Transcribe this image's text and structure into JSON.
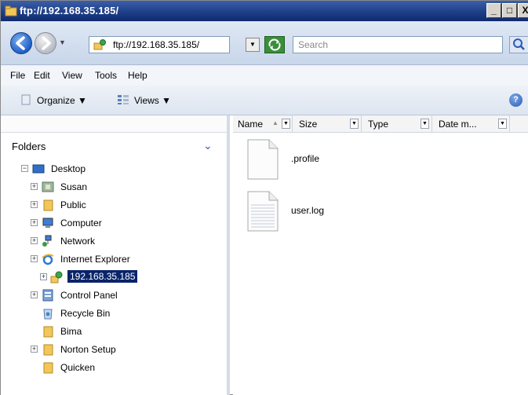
{
  "window": {
    "title": "ftp://192.168.35.185/",
    "controls": {
      "minimize": "_",
      "maximize": "□",
      "close": "X"
    }
  },
  "navbar": {
    "address": "ftp://192.168.35.185/",
    "search_placeholder": "Search"
  },
  "menu": {
    "items": [
      "File",
      "Edit",
      "View",
      "Tools",
      "Help"
    ]
  },
  "commandbar": {
    "organize": "Organize ▼",
    "views": "Views ▼",
    "help": "?"
  },
  "folders": {
    "header": "Folders",
    "tree": [
      {
        "label": "Desktop",
        "icon": "desktop-icon",
        "expander": "−"
      },
      {
        "label": "Susan",
        "icon": "user-folder-icon",
        "expander": "+"
      },
      {
        "label": "Public",
        "icon": "folder-icon",
        "expander": "+"
      },
      {
        "label": "Computer",
        "icon": "computer-icon",
        "expander": "+"
      },
      {
        "label": "Network",
        "icon": "network-icon",
        "expander": "+"
      },
      {
        "label": "Internet Explorer",
        "icon": "ie-icon",
        "expander": "+"
      },
      {
        "label": "192.168.35.185",
        "icon": "ftp-site-icon",
        "expander": "+",
        "selected": true
      },
      {
        "label": "Control Panel",
        "icon": "control-panel-icon",
        "expander": "+"
      },
      {
        "label": "Recycle Bin",
        "icon": "recycle-bin-icon",
        "expander": ""
      },
      {
        "label": "Bima",
        "icon": "folder-icon",
        "expander": ""
      },
      {
        "label": "Norton Setup",
        "icon": "folder-icon",
        "expander": "+"
      },
      {
        "label": "Quicken",
        "icon": "folder-icon",
        "expander": ""
      }
    ]
  },
  "columns": [
    "Name",
    "Size",
    "Type",
    "Date m..."
  ],
  "files": [
    {
      "name": ".profile",
      "icon": "blank-file-icon"
    },
    {
      "name": "user.log",
      "icon": "text-file-icon"
    }
  ],
  "colors": {
    "title_bar": "#1f3f88",
    "selection": "#0a246a",
    "folder": "#e8c060"
  }
}
